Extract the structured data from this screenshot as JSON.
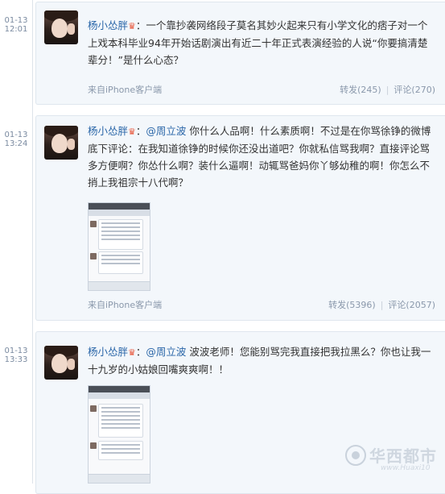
{
  "posts": [
    {
      "time": {
        "date": "01-13",
        "clock": "12:01"
      },
      "author": "杨小怂胖",
      "text": "一个靠抄袭网络段子莫名其妙火起来只有小学文化的痞子对一个上戏本科毕业94年开始话剧演出有近二十年正式表演经验的人说“你要搞清楚辈分！”是什么心态？",
      "source": "来自iPhone客户端",
      "repost": "转发(245)",
      "comment": "评论(270)"
    },
    {
      "time": {
        "date": "01-13",
        "clock": "13:24"
      },
      "author": "杨小怂胖",
      "mention": "@周立波",
      "text": "你什么人品啊！什么素质啊！不过是在你骂徐铮的微博底下评论：在我知道徐铮的时候你还没出道吧？你就私信骂我啊？直接评论骂多方便啊？你怂什么啊？装什么逼啊！动辄骂爸妈你丫够幼稚的啊！你怎么不捎上我祖宗十八代啊？",
      "source": "来自iPhone客户端",
      "repost": "转发(5396)",
      "comment": "评论(2057)"
    },
    {
      "time": {
        "date": "01-13",
        "clock": "13:33"
      },
      "author": "杨小怂胖",
      "mention": "@周立波",
      "text": "波波老师！您能别骂完我直接把我拉黑么？你也让我一十九岁的小姑娘回嘴爽爽啊！！"
    }
  ],
  "icons": {
    "badge": "crown-icon",
    "logo": "watermark-logo-icon"
  },
  "watermark": {
    "title": "华西都市",
    "url": "www.Huaxi10"
  },
  "colors": {
    "link": "#2a66a8",
    "badge": "#e8563a",
    "meta": "#8a98ab"
  }
}
